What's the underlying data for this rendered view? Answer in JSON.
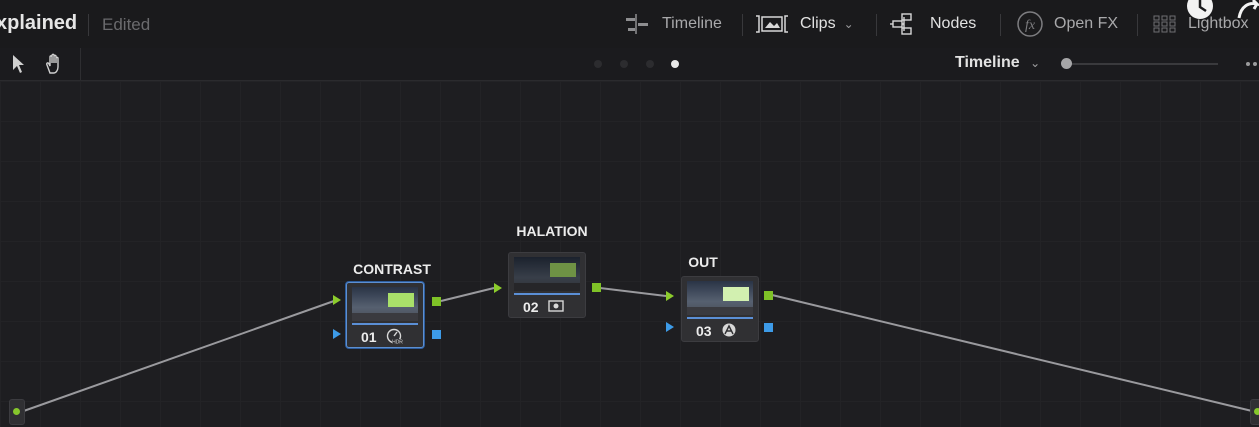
{
  "header": {
    "title": "xplained",
    "status": "Edited",
    "buttons": [
      {
        "label": "Timeline",
        "icon": "timeline-icon"
      },
      {
        "label": "Clips",
        "icon": "clips-icon"
      },
      {
        "label": "Nodes",
        "icon": "nodes-icon"
      },
      {
        "label": "Open FX",
        "icon": "fx-icon"
      },
      {
        "label": "Lightbox",
        "icon": "lightbox-icon"
      }
    ]
  },
  "toolbar": {
    "view_label": "Timeline",
    "tools": [
      "pointer-icon",
      "hand-icon"
    ],
    "page_dots_total": 4,
    "page_dot_active": 4
  },
  "nodes": [
    {
      "label": "CONTRAST",
      "number": "01",
      "icon": "hdr-icon",
      "selected": true
    },
    {
      "label": "HALATION",
      "number": "02",
      "icon": "effect-icon",
      "selected": false
    },
    {
      "label": "OUT",
      "number": "03",
      "icon": "color-icon",
      "selected": false
    }
  ],
  "colors": {
    "rgb_port": "#7fc227",
    "alpha_port": "#3d9be8",
    "selection": "#5d8fd0"
  }
}
